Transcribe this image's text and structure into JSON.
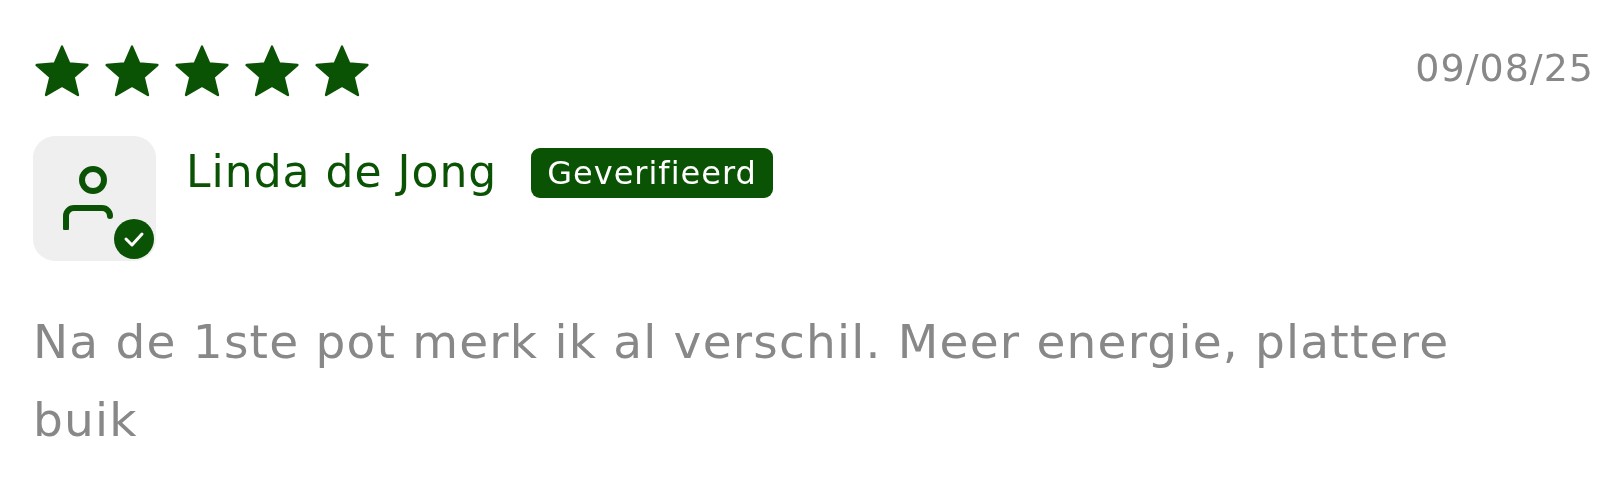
{
  "review": {
    "stars": 5,
    "date": "09/08/25",
    "reviewer": {
      "name": "Linda de Jong",
      "verified": true,
      "badge": "Geverifieerd"
    },
    "text": "Na de 1ste pot merk ik al verschil. Meer energie, plattere buik"
  }
}
